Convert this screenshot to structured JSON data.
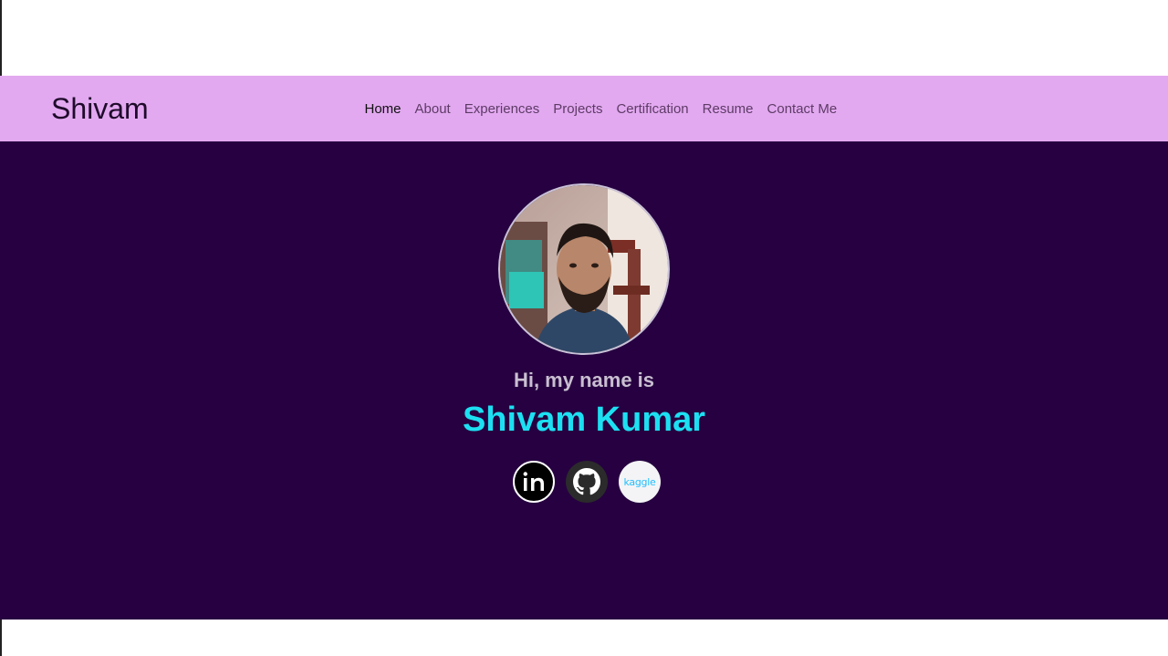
{
  "navbar": {
    "brand": "Shivam",
    "links": [
      {
        "label": "Home",
        "active": true
      },
      {
        "label": "About"
      },
      {
        "label": "Experiences"
      },
      {
        "label": "Projects"
      },
      {
        "label": "Certification"
      },
      {
        "label": "Resume"
      },
      {
        "label": "Contact Me"
      }
    ]
  },
  "hero": {
    "greeting": "Hi, my name is",
    "name": "Shivam Kumar",
    "socials": [
      {
        "icon": "linkedin-icon"
      },
      {
        "icon": "github-icon"
      },
      {
        "icon": "kaggle-icon",
        "text": "kaggle"
      }
    ]
  },
  "colors": {
    "navbar_bg": "#e2a9f0",
    "hero_bg": "#260040",
    "name_accent": "#1ce0f2",
    "greeting_text": "#c9bfd1"
  }
}
